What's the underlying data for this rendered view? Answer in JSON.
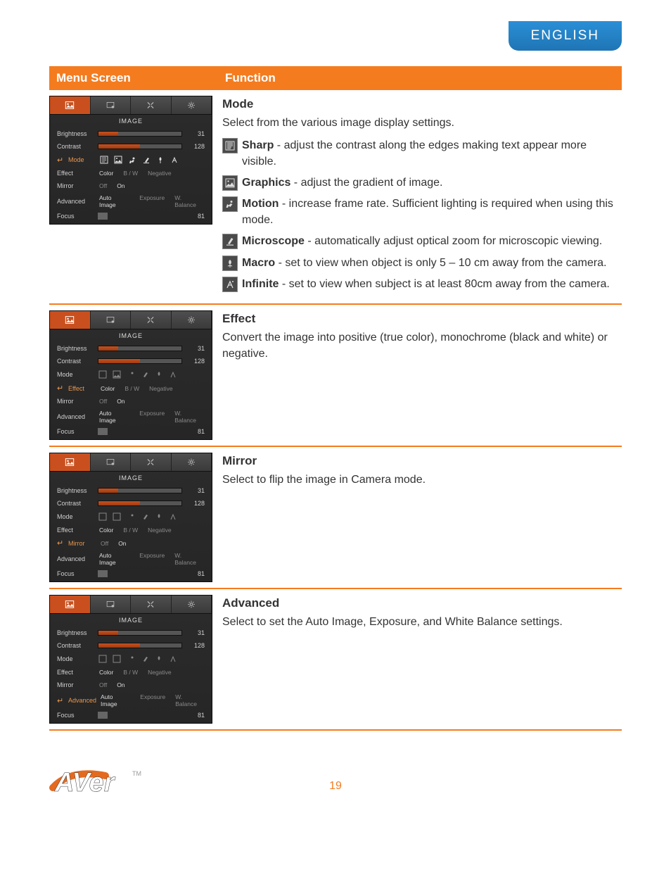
{
  "header": {
    "language_tab": "ENGLISH"
  },
  "table_header": {
    "menu_screen": "Menu Screen",
    "function": "Function"
  },
  "osd_common": {
    "title": "IMAGE",
    "brightness_label": "Brightness",
    "contrast_label": "Contrast",
    "mode_label": "Mode",
    "effect_label": "Effect",
    "mirror_label": "Mirror",
    "advanced_label": "Advanced",
    "focus_label": "Focus",
    "brightness_value": "31",
    "contrast_value": "128",
    "focus_value": "81",
    "effect_opts": {
      "color": "Color",
      "bw": "B / W",
      "negative": "Negative"
    },
    "mirror_opts": {
      "off": "Off",
      "on": "On"
    },
    "advanced_opts": {
      "auto_image": "Auto Image",
      "exposure": "Exposure",
      "wbalance": "W. Balance"
    }
  },
  "sections": {
    "mode": {
      "title": "Mode",
      "desc": "Select from the various image display settings.",
      "items": [
        {
          "name": "Sharp",
          "text": " - adjust the contrast along the edges making text appear more visible."
        },
        {
          "name": "Graphics",
          "text": " - adjust the gradient of image."
        },
        {
          "name": "Motion",
          "text": " - increase frame rate. Sufficient lighting is required when using this mode."
        },
        {
          "name": "Microscope",
          "text": " - automatically adjust optical zoom for microscopic viewing."
        },
        {
          "name": "Macro",
          "text": " - set to view when object is only 5 – 10 cm away from the camera."
        },
        {
          "name": "Infinite",
          "text": " - set to view when subject is at least 80cm away from the camera."
        }
      ]
    },
    "effect": {
      "title": "Effect",
      "desc": "Convert the image into positive (true color), monochrome (black and white) or negative."
    },
    "mirror": {
      "title": "Mirror",
      "desc": "Select to flip the image in Camera mode."
    },
    "advanced": {
      "title": "Advanced",
      "desc": "Select to set the Auto Image, Exposure, and White Balance settings."
    }
  },
  "footer": {
    "page_number": "19",
    "brand": "AVer"
  }
}
